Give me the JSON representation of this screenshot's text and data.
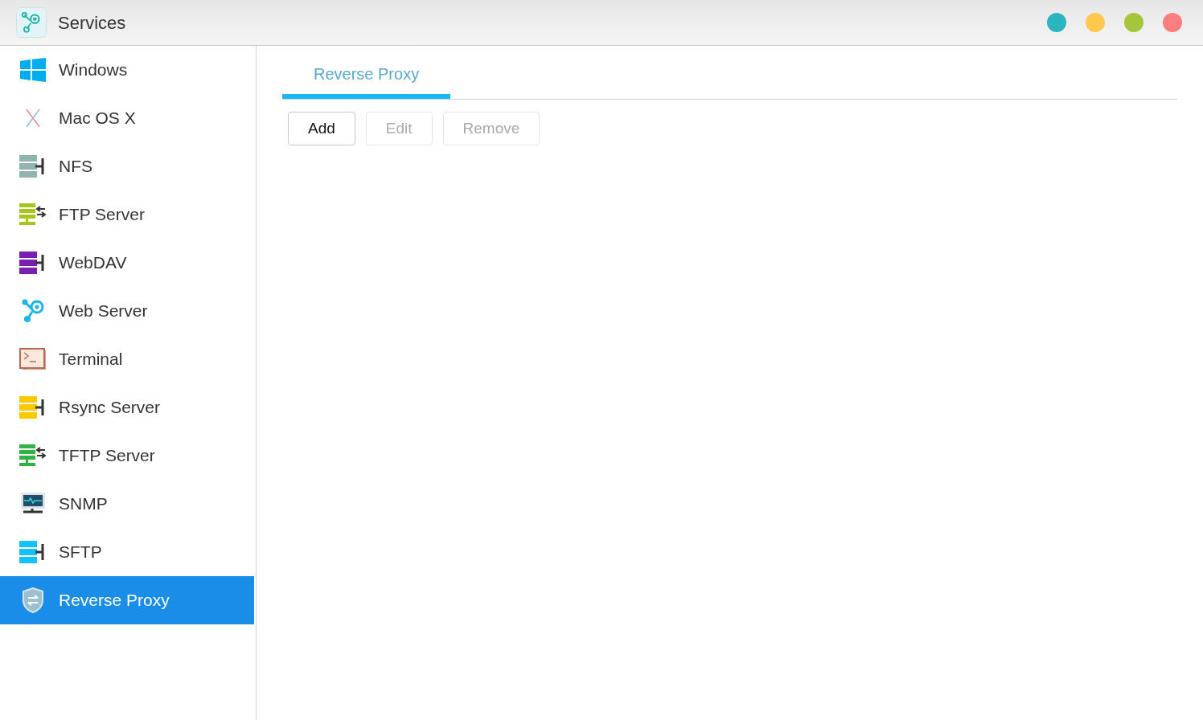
{
  "window": {
    "title": "Services",
    "controls": [
      {
        "color": "#2bb5be"
      },
      {
        "color": "#fec84d"
      },
      {
        "color": "#a5c53a"
      },
      {
        "color": "#fd7e7e"
      }
    ]
  },
  "sidebar": {
    "items": [
      {
        "label": "Windows",
        "kind": "windows",
        "selected": false
      },
      {
        "label": "Mac OS X",
        "kind": "mac",
        "selected": false
      },
      {
        "label": "NFS",
        "kind": "server",
        "color": "#8fb3ad",
        "selected": false
      },
      {
        "label": "FTP Server",
        "kind": "transfer",
        "color": "#a6c61e",
        "selected": false
      },
      {
        "label": "WebDAV",
        "kind": "server",
        "color": "#7a1fb3",
        "selected": false
      },
      {
        "label": "Web Server",
        "kind": "web",
        "selected": false
      },
      {
        "label": "Terminal",
        "kind": "terminal",
        "selected": false
      },
      {
        "label": "Rsync Server",
        "kind": "server",
        "color": "#fcc900",
        "selected": false
      },
      {
        "label": "TFTP Server",
        "kind": "transfer",
        "color": "#2fb344",
        "selected": false
      },
      {
        "label": "SNMP",
        "kind": "snmp",
        "selected": false
      },
      {
        "label": "SFTP",
        "kind": "server",
        "color": "#12c2f8",
        "selected": false
      },
      {
        "label": "Reverse Proxy",
        "kind": "shield",
        "selected": true
      }
    ]
  },
  "tabs": [
    {
      "label": "Reverse Proxy",
      "selected": true
    }
  ],
  "buttons": [
    {
      "label": "Add",
      "disabled": false
    },
    {
      "label": "Edit",
      "disabled": true
    },
    {
      "label": "Remove",
      "disabled": true
    }
  ]
}
